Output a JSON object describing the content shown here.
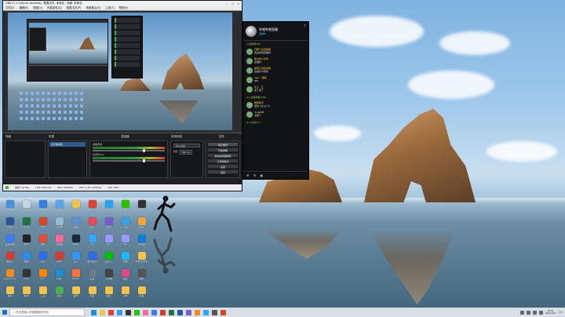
{
  "obs": {
    "title": "OBS 27.1.3 (64-bit, windows) - 配置文件: 未命名 - 场景: 未命名",
    "menu": [
      "文件(F)",
      "编辑(E)",
      "视图(V)",
      "停靠部件(D)",
      "配置文件(P)",
      "场景集合(S)",
      "工具(T)",
      "帮助(H)"
    ],
    "docks": {
      "scenes": "场景",
      "sources": "来源",
      "mixer": "混音器",
      "transitions": "转场特效",
      "controls": "控件"
    },
    "source_item": "显示器采集",
    "mixer_tracks": [
      "桌面音频",
      "麦克风/Aux"
    ],
    "transition": "淡入淡出",
    "duration_label": "时长",
    "duration_value": "300 ms",
    "controls": [
      "停止推流",
      "开始录制",
      "启动虚拟摄像机",
      "工作室模式",
      "设置",
      "退出"
    ],
    "status": [
      "丢帧 0 (0.0%)",
      "LIVE: 00:01:23",
      "REC: 00:00:00",
      "CPU: 4.1%, 30.00 fps",
      "kb/s: 2500"
    ],
    "status_live": "LIVE"
  },
  "chat": {
    "room_name": "哔哩哔哩直播",
    "room_status": "直播中",
    "section_top": "小窗弹幕(0/0)",
    "messages": [
      {
        "name": "闪耀飞鸟的黑暗",
        "body": "欢迎来到直播间"
      },
      {
        "name": "路过的小伙伴",
        "body": "主播好"
      },
      {
        "name": "星辰大海的旅客",
        "body": "这是什么软件"
      },
      {
        "name": "Tiger · 喵喵",
        "body": "666"
      },
      {
        "name": "木子 · 日",
        "body": "来了来了"
      }
    ],
    "section_mid": "Hot 直播弹幕(3/60)",
    "messages2": [
      {
        "name": "弹幕助手",
        "body": "送出 小心心 x1"
      },
      {
        "name": "Jiang888",
        "body": "点赞了"
      }
    ],
    "section_bottom": "Hot 礼物(0/1)",
    "footer_icons": [
      "gift-icon",
      "settings-icon",
      "lock-icon"
    ]
  },
  "desktop": {
    "icons": [
      {
        "label": "此电脑",
        "color": "#4a90d9"
      },
      {
        "label": "回收站",
        "color": "#c7d3df"
      },
      {
        "label": "控制面板",
        "color": "#3b7ddd"
      },
      {
        "label": "网络",
        "color": "#5ba3e6"
      },
      {
        "label": "文档",
        "color": "#f0c24a"
      },
      {
        "label": "Chrome",
        "color": "#e34133"
      },
      {
        "label": "QQ",
        "color": "#2aa2ef"
      },
      {
        "label": "微信",
        "color": "#2dc100"
      },
      {
        "label": "OBS",
        "color": "#333333"
      },
      {
        "label": "Word",
        "color": "#2b579a"
      },
      {
        "label": "Excel",
        "color": "#217346"
      },
      {
        "label": "PPT",
        "color": "#d24726"
      },
      {
        "label": "记事本",
        "color": "#9bb7d6"
      },
      {
        "label": "截图",
        "color": "#5f8fd0"
      },
      {
        "label": "音乐",
        "color": "#e84b5b"
      },
      {
        "label": "视频",
        "color": "#7b5ccf"
      },
      {
        "label": "下载",
        "color": "#3aa0e8"
      },
      {
        "label": "图片",
        "color": "#f2a33a"
      },
      {
        "label": "百度网盘",
        "color": "#3a7ef0"
      },
      {
        "label": "剪映",
        "color": "#222222"
      },
      {
        "label": "录屏",
        "color": "#e34b3b"
      },
      {
        "label": "直播姬",
        "color": "#ff6699"
      },
      {
        "label": "Steam",
        "color": "#1b2838"
      },
      {
        "label": "PS",
        "color": "#31a8ff"
      },
      {
        "label": "PR",
        "color": "#9999ff"
      },
      {
        "label": "AE",
        "color": "#9999ff"
      },
      {
        "label": "浏览器",
        "color": "#0f7dd6"
      },
      {
        "label": "网易云",
        "color": "#d43c33"
      },
      {
        "label": "酷狗",
        "color": "#2b8cf0"
      },
      {
        "label": "迅雷",
        "color": "#2f6df0"
      },
      {
        "label": "WPS",
        "color": "#d93b2b"
      },
      {
        "label": "钉钉",
        "color": "#3296fa"
      },
      {
        "label": "腾讯会议",
        "color": "#2b6fe8"
      },
      {
        "label": "爱奇艺",
        "color": "#00be06"
      },
      {
        "label": "优酷",
        "color": "#1ebaff"
      },
      {
        "label": "新建文件夹",
        "color": "#f3c34f"
      },
      {
        "label": "Everything",
        "color": "#f08a24"
      },
      {
        "label": "7-Zip",
        "color": "#333333"
      },
      {
        "label": "VLC",
        "color": "#ff8800"
      },
      {
        "label": "Edge",
        "color": "#1e8fd1"
      },
      {
        "label": "Firefox",
        "color": "#ff7139"
      },
      {
        "label": "设置",
        "color": "#6b7b8c"
      },
      {
        "label": "计算器",
        "color": "#444444"
      },
      {
        "label": "画图",
        "color": "#e04a8a"
      },
      {
        "label": "相机",
        "color": "#555555"
      },
      {
        "label": "资料",
        "color": "#f3c34f"
      },
      {
        "label": "素材",
        "color": "#f3c34f"
      },
      {
        "label": "工具",
        "color": "#f3c34f"
      },
      {
        "label": "游戏",
        "color": "#4caf50"
      },
      {
        "label": "备份",
        "color": "#f3c34f"
      },
      {
        "label": "项目",
        "color": "#f3c34f"
      },
      {
        "label": "图标",
        "color": "#f3c34f"
      },
      {
        "label": "字体",
        "color": "#f3c34f"
      },
      {
        "label": "模板",
        "color": "#f3c34f"
      }
    ]
  },
  "taskbar": {
    "search_placeholder": "在这里输入你要搜索的内容",
    "apps": [
      "#1e8fd1",
      "#f3c34f",
      "#e34133",
      "#2aa2ef",
      "#333333",
      "#2dc100",
      "#ff6699",
      "#3a7ef0",
      "#d43c33",
      "#217346",
      "#2b579a",
      "#7b5ccf",
      "#f08a24",
      "#31a8ff",
      "#555555",
      "#d24726"
    ],
    "time": "15:01",
    "date": "2021/12/1"
  }
}
